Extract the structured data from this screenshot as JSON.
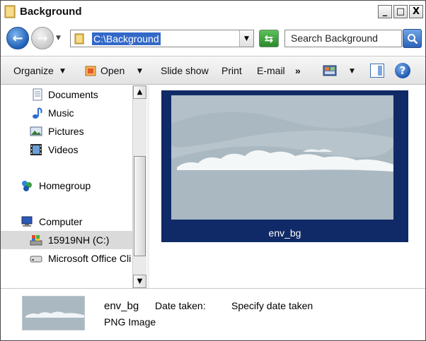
{
  "window": {
    "title": "Background",
    "controls": {
      "minimize": "_",
      "maximize": "□",
      "close": "X"
    }
  },
  "address": {
    "path": "C:\\Background",
    "search_placeholder": "Search Background"
  },
  "toolbar": {
    "organize": "Organize",
    "open": "Open",
    "slideshow": "Slide show",
    "print": "Print",
    "email": "E-mail",
    "more": "»",
    "help": "?"
  },
  "nav": {
    "items": [
      {
        "label": "Documents",
        "icon": "documents-icon"
      },
      {
        "label": "Music",
        "icon": "music-icon"
      },
      {
        "label": "Pictures",
        "icon": "pictures-icon"
      },
      {
        "label": "Videos",
        "icon": "videos-icon"
      },
      {
        "label": "Homegroup",
        "icon": "homegroup-icon"
      },
      {
        "label": "Computer",
        "icon": "computer-icon"
      },
      {
        "label": "15919NH (C:)",
        "icon": "drive-icon",
        "selected": true
      },
      {
        "label": "Microsoft Office Cli",
        "icon": "removable-drive-icon"
      }
    ]
  },
  "files": [
    {
      "name": "env_bg",
      "selected": true
    }
  ],
  "details": {
    "name": "env_bg",
    "type": "PNG Image",
    "date_label": "Date taken:",
    "date_value": "Specify date taken"
  },
  "colors": {
    "selection": "#0f2a66",
    "address_highlight": "#3268c8",
    "sky": "#aab8c1"
  }
}
